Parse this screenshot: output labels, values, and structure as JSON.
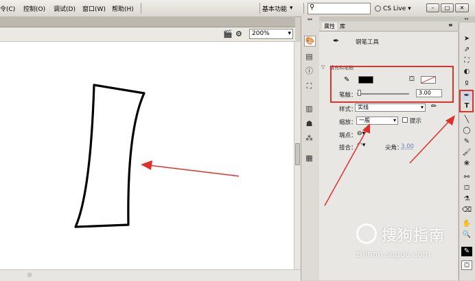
{
  "menubar": {
    "items": [
      "令(C)",
      "控制(O)",
      "调试(D)",
      "窗口(W)",
      "帮助(H)"
    ],
    "workspace": "基本功能",
    "cs_live": "CS Live"
  },
  "stage": {
    "zoom": "200%"
  },
  "properties_panel": {
    "tabs": [
      "属性",
      "库"
    ],
    "tool_name": "钢笔工具",
    "section_title": "填充和笔触",
    "stroke_label": "笔触：",
    "stroke_value": "3.00",
    "style_label": "样式：",
    "style_value": "实线",
    "scale_label": "缩放：",
    "scale_value": "一般",
    "hint_label": "提示",
    "cap_label": "端点：",
    "join_label": "接合：",
    "miter_label": "尖角：",
    "miter_value": "3.00"
  },
  "watermark": {
    "text": "搜狗指南",
    "url": "zhinan.sogou.com"
  },
  "colors": {
    "annotation": "#e0302a",
    "stroke_color": "#000000"
  }
}
